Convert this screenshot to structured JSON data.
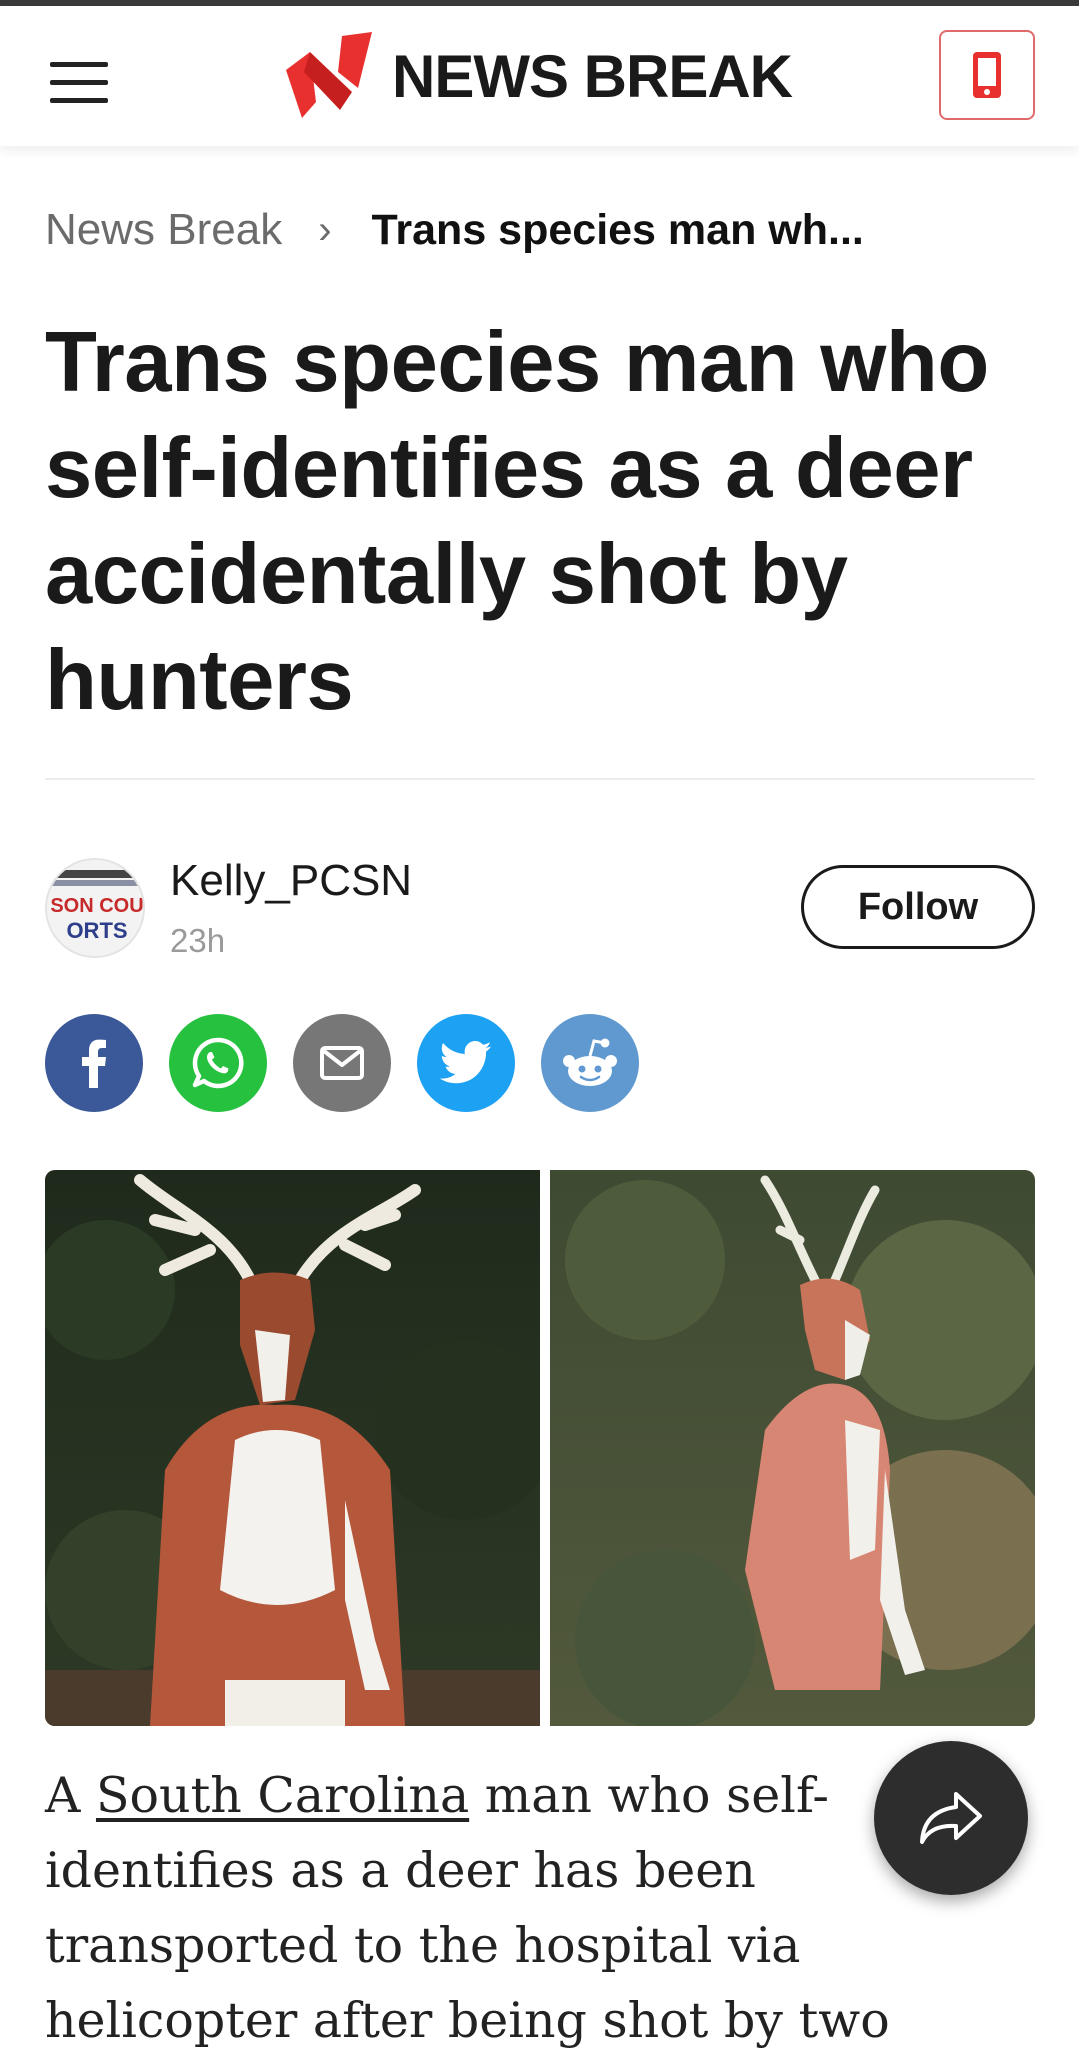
{
  "header": {
    "brand_name": "NEWS BREAK",
    "brand_color": "#e8312f",
    "menu_icon": "hamburger-menu-icon",
    "app_icon": "mobile-phone-icon"
  },
  "breadcrumb": {
    "home": "News Break",
    "separator": "›",
    "current": "Trans species man wh..."
  },
  "article": {
    "title": "Trans species man who self-identifies as a deer accidentally shot by hunters",
    "author": {
      "name": "Kelly_PCSN",
      "time": "23h",
      "avatar_text_top": "SON COU",
      "avatar_text_bottom": "ORTS"
    },
    "follow_label": "Follow",
    "body_before_link": "A ",
    "body_link": "South Carolina",
    "body_after_link": " man who self-identifies as a deer has been transported to the hospital via helicopter after being shot by two"
  },
  "share": [
    {
      "name": "facebook",
      "color": "#3b5998",
      "icon": "facebook-icon"
    },
    {
      "name": "whatsapp",
      "color": "#25c13f",
      "icon": "whatsapp-icon"
    },
    {
      "name": "email",
      "color": "#777777",
      "icon": "email-icon"
    },
    {
      "name": "twitter",
      "color": "#1da1f2",
      "icon": "twitter-icon"
    },
    {
      "name": "reddit",
      "color": "#5f99cf",
      "icon": "reddit-icon"
    }
  ],
  "fab": {
    "icon": "share-arrow-icon",
    "color": "#2d2d2d"
  }
}
